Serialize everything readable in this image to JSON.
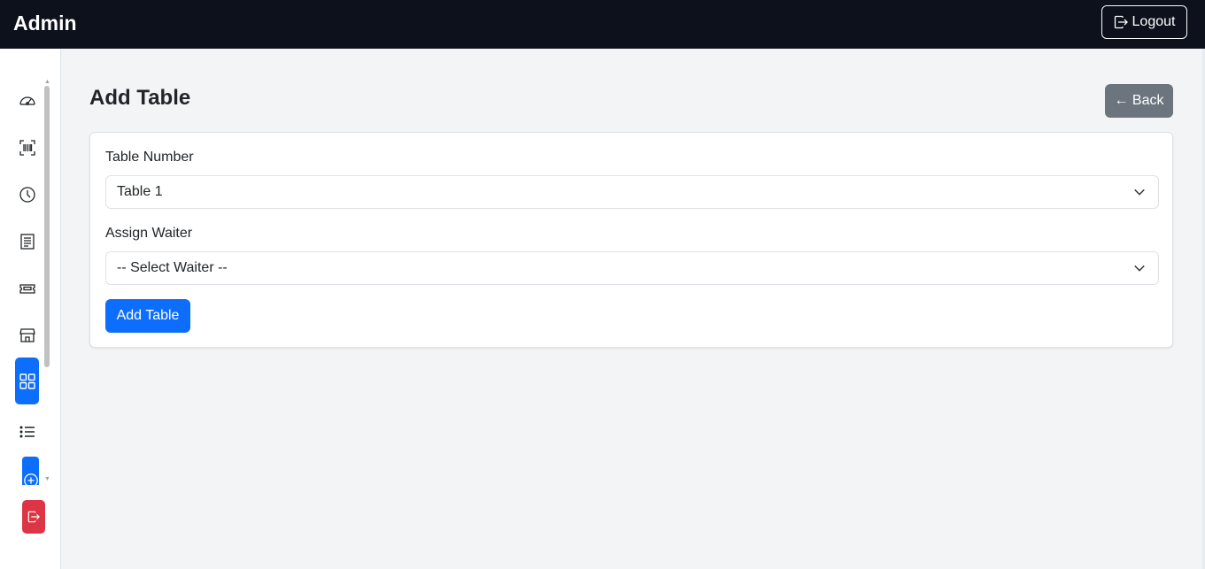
{
  "navbar": {
    "brand": "Admin",
    "logout_label": "Logout"
  },
  "sidebar": {
    "items": [
      {
        "icon": "speedometer-icon"
      },
      {
        "icon": "barcode-scan-icon"
      },
      {
        "icon": "clock-history-icon"
      },
      {
        "icon": "receipt-icon"
      },
      {
        "icon": "ticket-icon"
      },
      {
        "icon": "shop-icon"
      },
      {
        "icon": "grid-icon",
        "active": true
      },
      {
        "icon": "list-icon"
      },
      {
        "icon": "plus-circle-icon",
        "active": true
      },
      {
        "icon": "box-arrow-right-icon"
      }
    ],
    "accent": "#0d6efd",
    "danger": "#dc3545"
  },
  "page": {
    "title": "Add Table",
    "back_label": "← Back"
  },
  "form": {
    "table_number": {
      "label": "Table Number",
      "selected": "Table 1"
    },
    "assign_waiter": {
      "label": "Assign Waiter",
      "selected": "-- Select Waiter --"
    },
    "submit_label": "Add Table"
  }
}
